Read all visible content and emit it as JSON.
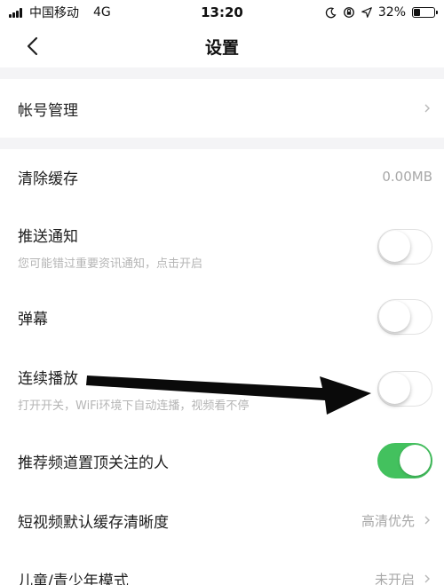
{
  "status_bar": {
    "carrier": "中国移动",
    "network": "4G",
    "time": "13:20",
    "battery_text": "32%",
    "battery_level": 0.32
  },
  "nav": {
    "title": "设置"
  },
  "rows": {
    "account": {
      "label": "帐号管理"
    },
    "cache": {
      "label": "清除缓存",
      "value": "0.00MB"
    },
    "push": {
      "label": "推送通知",
      "sub": "您可能错过重要资讯通知，点击开启",
      "on": false
    },
    "danmaku": {
      "label": "弹幕",
      "on": false
    },
    "autoplay": {
      "label": "连续播放",
      "sub": "打开开关，WiFi环境下自动连播，视频看不停",
      "on": false
    },
    "pin_follow": {
      "label": "推荐频道置顶关注的人",
      "on": true
    },
    "video_quality": {
      "label": "短视频默认缓存清晰度",
      "value": "高清优先"
    },
    "kids_mode": {
      "label": "儿童/青少年模式",
      "value": "未开启"
    }
  },
  "colors": {
    "toggle_on": "#43c15e",
    "section_gap": "#f4f4f6",
    "annotation_arrow": "#0a0a0a"
  },
  "annotation": {
    "type": "arrow",
    "points_to": "autoplay-toggle"
  }
}
